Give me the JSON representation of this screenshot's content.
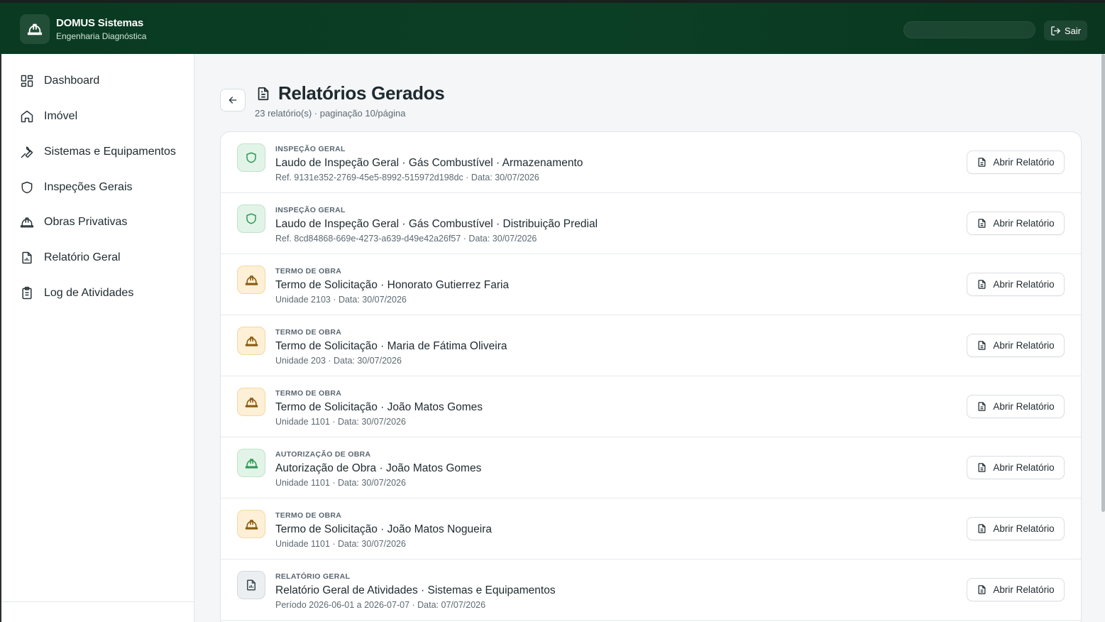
{
  "app": {
    "title": "DOMUS Sistemas",
    "subtitle": "Engenharia Diagnóstica",
    "logout_label": "Sair",
    "accent": "#0b3f25"
  },
  "sidebar": {
    "items": [
      {
        "label": "Dashboard",
        "icon": "dashboard-icon"
      },
      {
        "label": "Imóvel",
        "icon": "home-icon"
      },
      {
        "label": "Sistemas e Equipamentos",
        "icon": "wrench-icon"
      },
      {
        "label": "Inspeções Gerais",
        "icon": "shield-icon"
      },
      {
        "label": "Obras Privativas",
        "icon": "hard-hat-icon"
      },
      {
        "label": "Relatório Geral",
        "icon": "report-icon"
      },
      {
        "label": "Log de Atividades",
        "icon": "clipboard-icon"
      }
    ]
  },
  "page": {
    "title": "Relatórios Gerados",
    "subtitle": "23 relatório(s) · paginação 10/página"
  },
  "reports": {
    "open_label": "Abrir Relatório",
    "rows": [
      {
        "kicker": "INSPEÇÃO GERAL",
        "title": "Laudo de Inspeção Geral · Gás Combustível · Armazenamento",
        "meta": "Ref. 9131e352-2769-45e5-8992-515972d198dc · Data: 30/07/2026",
        "icon": "shield-icon",
        "tone": "green"
      },
      {
        "kicker": "INSPEÇÃO GERAL",
        "title": "Laudo de Inspeção Geral · Gás Combustível · Distribuição Predial",
        "meta": "Ref. 8cd84868-669e-4273-a639-d49e42a26f57 · Data: 30/07/2026",
        "icon": "shield-icon",
        "tone": "green"
      },
      {
        "kicker": "TERMO DE OBRA",
        "title": "Termo de Solicitação · Honorato Gutierrez Faria",
        "meta": "Unidade 2103 · Data: 30/07/2026",
        "icon": "hard-hat-icon",
        "tone": "amber"
      },
      {
        "kicker": "TERMO DE OBRA",
        "title": "Termo de Solicitação · Maria de Fátima Oliveira",
        "meta": "Unidade 203 · Data: 30/07/2026",
        "icon": "hard-hat-icon",
        "tone": "amber"
      },
      {
        "kicker": "TERMO DE OBRA",
        "title": "Termo de Solicitação · João Matos Gomes",
        "meta": "Unidade 1101 · Data: 30/07/2026",
        "icon": "hard-hat-icon",
        "tone": "amber"
      },
      {
        "kicker": "AUTORIZAÇÃO DE OBRA",
        "title": "Autorização de Obra · João Matos Gomes",
        "meta": "Unidade 1101 · Data: 30/07/2026",
        "icon": "hard-hat-icon",
        "tone": "green"
      },
      {
        "kicker": "TERMO DE OBRA",
        "title": "Termo de Solicitação · João Matos Nogueira",
        "meta": "Unidade 1101 · Data: 30/07/2026",
        "icon": "hard-hat-icon",
        "tone": "amber"
      },
      {
        "kicker": "RELATÓRIO GERAL",
        "title": "Relatório Geral de Atividades · Sistemas e Equipamentos",
        "meta": "Período 2026-06-01 a 2026-07-07 · Data: 07/07/2026",
        "icon": "report-icon",
        "tone": "gray"
      }
    ]
  }
}
